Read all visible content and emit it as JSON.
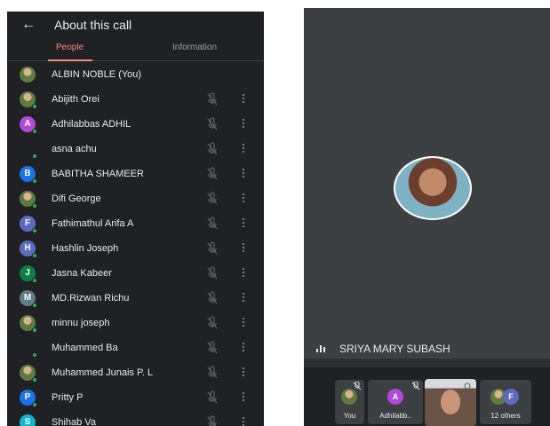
{
  "header": {
    "back_glyph": "←",
    "title": "About this call"
  },
  "tabs": [
    {
      "label": "People",
      "active": true
    },
    {
      "label": "Information",
      "active": false
    }
  ],
  "participants": [
    {
      "name": "ALBIN NOBLE (You)",
      "avatar": "photo",
      "initial": "",
      "color": "",
      "online": false,
      "self": true
    },
    {
      "name": "Abijith Orei",
      "avatar": "photo",
      "initial": "",
      "color": "",
      "online": true,
      "self": false
    },
    {
      "name": "Adhilabbas ADHIL",
      "avatar": "letter",
      "initial": "A",
      "color": "#b04ad8",
      "online": true,
      "self": false
    },
    {
      "name": "asna achu",
      "avatar": "empty",
      "initial": "",
      "color": "",
      "online": true,
      "self": false
    },
    {
      "name": "BABITHA SHAMEER",
      "avatar": "letter",
      "initial": "B",
      "color": "#1a73e8",
      "online": true,
      "self": false
    },
    {
      "name": "Difi George",
      "avatar": "photo",
      "initial": "",
      "color": "",
      "online": true,
      "self": false
    },
    {
      "name": "Fathimathul Arifa A",
      "avatar": "letter",
      "initial": "F",
      "color": "#5c6bc0",
      "online": true,
      "self": false
    },
    {
      "name": "Hashlin Joseph",
      "avatar": "letter",
      "initial": "H",
      "color": "#5c6bc0",
      "online": true,
      "self": false
    },
    {
      "name": "Jasna Kabeer",
      "avatar": "letter",
      "initial": "J",
      "color": "#0b8043",
      "online": true,
      "self": false
    },
    {
      "name": "MD.Rizwan Richu",
      "avatar": "letter",
      "initial": "M",
      "color": "#607d8b",
      "online": true,
      "self": false
    },
    {
      "name": "minnu joseph",
      "avatar": "photo",
      "initial": "",
      "color": "",
      "online": true,
      "self": false
    },
    {
      "name": "Muhammed Ba",
      "avatar": "empty",
      "initial": "",
      "color": "",
      "online": true,
      "self": false
    },
    {
      "name": "Muhammed Junais P. L",
      "avatar": "photo",
      "initial": "",
      "color": "",
      "online": true,
      "self": false
    },
    {
      "name": "Pritty P",
      "avatar": "letter",
      "initial": "P",
      "color": "#1a73e8",
      "online": true,
      "self": false
    },
    {
      "name": "Shihab Va",
      "avatar": "letter",
      "initial": "S",
      "color": "#12b5cb",
      "online": true,
      "self": false
    }
  ],
  "stage": {
    "speaker_name": "SRIYA MARY SUBASH"
  },
  "strip": [
    {
      "label": "You",
      "kind": "photo",
      "initial": "",
      "color": ""
    },
    {
      "label": "Adhilabb..",
      "kind": "letter",
      "initial": "A",
      "color": "#b04ad8"
    },
    {
      "label": "",
      "kind": "video",
      "initial": "",
      "color": ""
    },
    {
      "label": "12 others",
      "kind": "group",
      "initial": "F",
      "color": "#5c6bc0"
    }
  ],
  "colors": {
    "panel_bg": "#202124",
    "stage_bg": "#3c4043",
    "accent": "#f28b82",
    "online": "#34a853"
  }
}
